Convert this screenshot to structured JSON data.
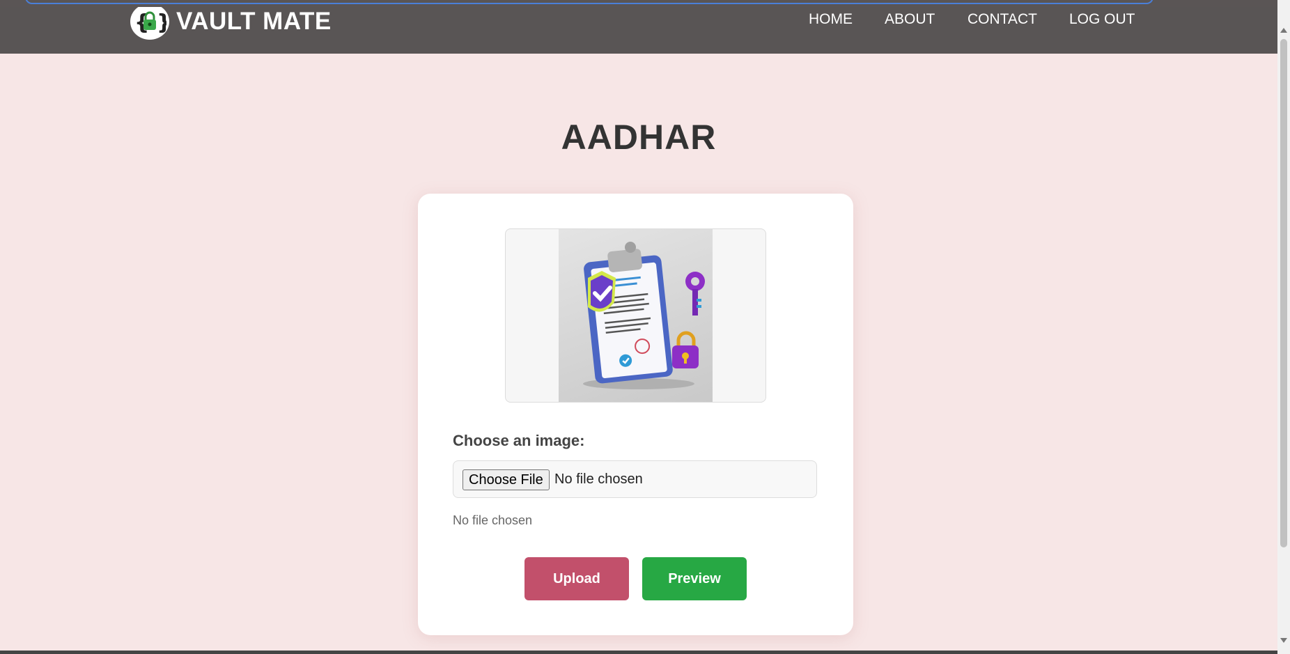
{
  "nav": {
    "brand": "VAULT MATE",
    "links": [
      "HOME",
      "ABOUT",
      "CONTACT",
      "LOG OUT"
    ]
  },
  "page": {
    "title": "AADHAR"
  },
  "form": {
    "label": "Choose an image:",
    "choose_button": "Choose File",
    "file_status_inline": "No file chosen",
    "file_status": "No file chosen",
    "upload_label": "Upload",
    "preview_label": "Preview"
  },
  "colors": {
    "navbar": "#595555",
    "background": "#f7e6e6",
    "upload": "#c2506b",
    "preview": "#27a844"
  }
}
